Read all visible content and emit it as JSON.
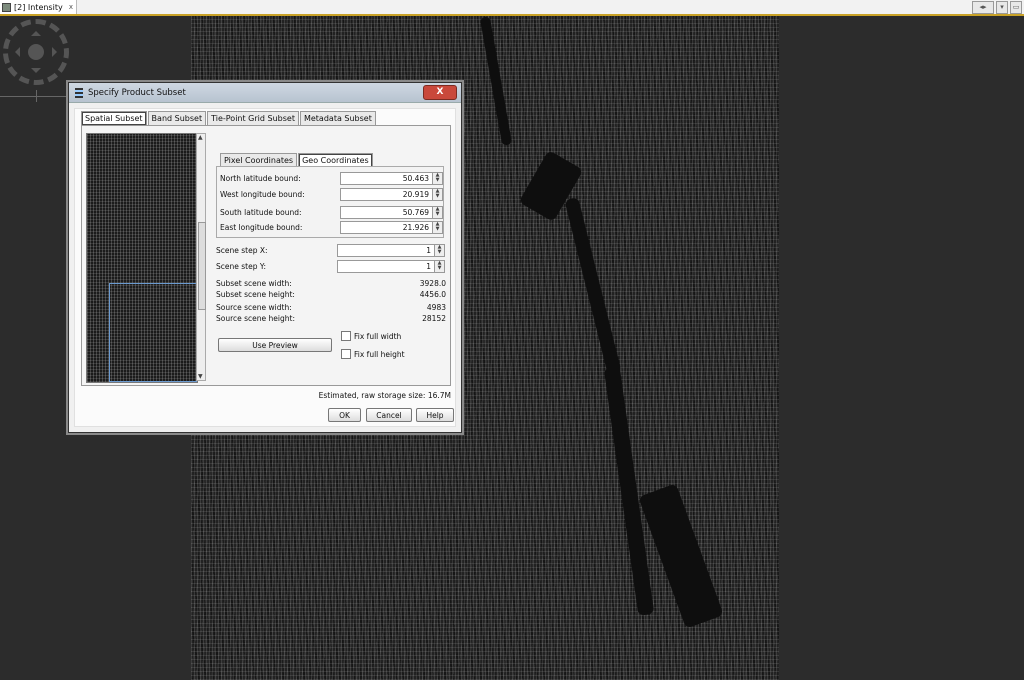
{
  "doc_tab": {
    "title": "[2] Intensity",
    "close": "x"
  },
  "window_controls": [
    "◂▸",
    "▾",
    "▭"
  ],
  "dialog": {
    "title": "Specify Product Subset",
    "close_glyph": "X",
    "tabs": [
      "Spatial Subset",
      "Band Subset",
      "Tie-Point Grid Subset",
      "Metadata Subset"
    ],
    "coord_tabs": [
      "Pixel Coordinates",
      "Geo Coordinates"
    ],
    "geo": {
      "north_label": "North latitude bound:",
      "north_value": "50.463",
      "west_label": "West longitude bound:",
      "west_value": "20.919",
      "south_label": "South latitude bound:",
      "south_value": "50.769",
      "east_label": "East longitude bound:",
      "east_value": "21.926"
    },
    "step_x_label": "Scene step X:",
    "step_x_value": "1",
    "step_y_label": "Scene step Y:",
    "step_y_value": "1",
    "info": [
      {
        "label": "Subset scene width:",
        "value": "3928.0"
      },
      {
        "label": "Subset scene height:",
        "value": "4456.0"
      },
      {
        "label": "Source scene width:",
        "value": "4983"
      },
      {
        "label": "Source scene height:",
        "value": "28152"
      }
    ],
    "use_preview": "Use Preview",
    "fix_width": "Fix full width",
    "fix_height": "Fix full height",
    "storage": "Estimated, raw storage size: 16.7M",
    "ok": "OK",
    "cancel": "Cancel",
    "help": "Help"
  }
}
